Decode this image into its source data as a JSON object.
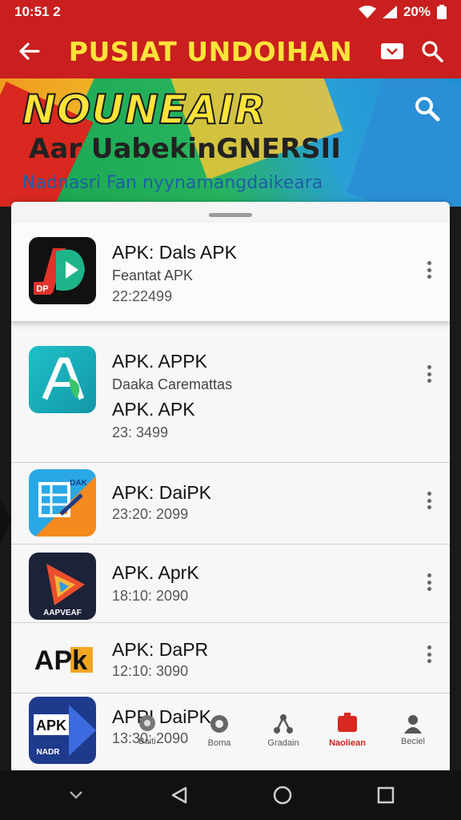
{
  "status": {
    "time": "10:51 2",
    "battery": "20%"
  },
  "appbar": {
    "title": "PUSIAT UNDOIHAN"
  },
  "banner": {
    "heading": "NOUNEAIR",
    "subheading": "Aar UabekinGNERSII",
    "tagline": "Nadnasri Fan nyynamangdaikeara"
  },
  "apps": [
    {
      "title": "APK: Dals APK",
      "subtitle": "Feantat APK",
      "date": "22:22499",
      "icon": "play-store-icon",
      "badge": "DP"
    },
    {
      "title": "APK. APPK",
      "subtitle": "Daaka Caremattas",
      "title2": "APK. APK",
      "date": "23: 3499",
      "icon": "letter-a-icon"
    },
    {
      "title": "APK: DaiPK",
      "date": "23:20: 2099",
      "icon": "transfer-grid-icon",
      "badge": "DAK"
    },
    {
      "title": "APK. AprK",
      "date": "18:10: 2090",
      "icon": "play-triangle-icon",
      "badge": "AAPVEAF"
    },
    {
      "title": "APK: DaPR",
      "date": "12:10: 3090",
      "icon": "apk-logo-icon",
      "logo_text": "APk"
    },
    {
      "title": "APPI DaiPK",
      "date": "13:30: 2090",
      "icon": "apk-shield-icon",
      "badge": "NADR",
      "logo_text": "APK"
    }
  ],
  "nav": [
    {
      "label": "Baiti",
      "icon": "home-icon"
    },
    {
      "label": "Boma",
      "icon": "settings-icon"
    },
    {
      "label": "Gradain",
      "icon": "share-icon"
    },
    {
      "label": "Naoliean",
      "icon": "bookmark-icon",
      "active": true
    },
    {
      "label": "Beciel",
      "icon": "profile-icon"
    }
  ],
  "colors": {
    "primary": "#c91f1f",
    "accent": "#ffe33a"
  }
}
